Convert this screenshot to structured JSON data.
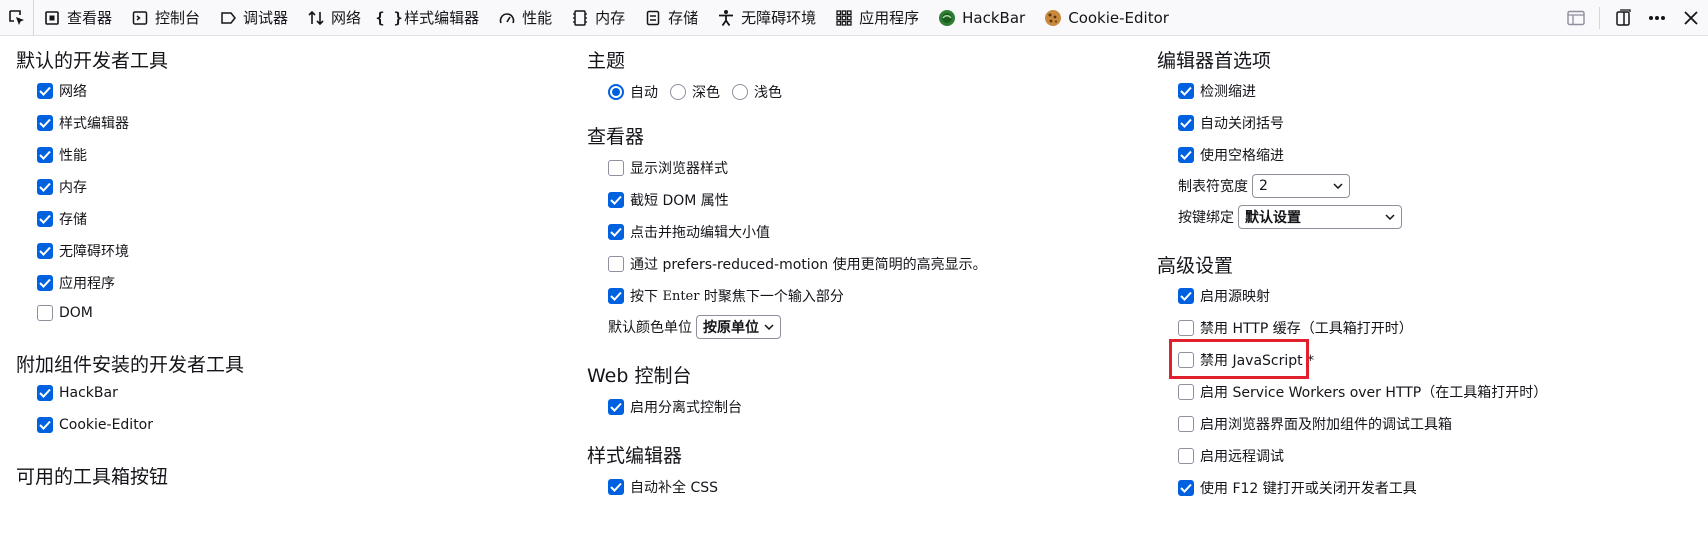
{
  "toolbar": {
    "tabs": [
      {
        "label": "查看器",
        "icon": "inspector-icon"
      },
      {
        "label": "控制台",
        "icon": "console-icon"
      },
      {
        "label": "调试器",
        "icon": "debugger-icon"
      },
      {
        "label": "网络",
        "icon": "network-icon"
      },
      {
        "label": "样式编辑器",
        "icon": "style-editor-icon"
      },
      {
        "label": "性能",
        "icon": "performance-icon"
      },
      {
        "label": "内存",
        "icon": "memory-icon"
      },
      {
        "label": "存储",
        "icon": "storage-icon"
      },
      {
        "label": "无障碍环境",
        "icon": "accessibility-icon"
      },
      {
        "label": "应用程序",
        "icon": "application-icon"
      },
      {
        "label": "HackBar",
        "icon": "hackbar-icon"
      },
      {
        "label": "Cookie-Editor",
        "icon": "cookie-icon"
      }
    ]
  },
  "default_tools": {
    "title": "默认的开发者工具",
    "items": [
      {
        "label": "网络",
        "checked": true
      },
      {
        "label": "样式编辑器",
        "checked": true
      },
      {
        "label": "性能",
        "checked": true
      },
      {
        "label": "内存",
        "checked": true
      },
      {
        "label": "存储",
        "checked": true
      },
      {
        "label": "无障碍环境",
        "checked": true
      },
      {
        "label": "应用程序",
        "checked": true
      },
      {
        "label": "DOM",
        "checked": false
      }
    ]
  },
  "addon_tools": {
    "title": "附加组件安装的开发者工具",
    "items": [
      {
        "label": "HackBar",
        "checked": true
      },
      {
        "label": "Cookie-Editor",
        "checked": true
      }
    ]
  },
  "toolbox_buttons": {
    "title": "可用的工具箱按钮"
  },
  "theme": {
    "title": "主题",
    "options": [
      {
        "label": "自动",
        "selected": true
      },
      {
        "label": "深色",
        "selected": false
      },
      {
        "label": "浅色",
        "selected": false
      }
    ]
  },
  "inspector": {
    "title": "查看器",
    "items": [
      {
        "label": "显示浏览器样式",
        "checked": false
      },
      {
        "label": "截短 DOM 属性",
        "checked": true
      },
      {
        "label": "点击并拖动编辑大小值",
        "checked": true
      },
      {
        "label": "通过 prefers-reduced-motion 使用更简明的高亮显示。",
        "checked": false
      }
    ],
    "enter_item": {
      "prefix": "按下 ",
      "key": "Enter",
      "suffix": " 时聚焦下一个输入部分",
      "checked": true
    },
    "color_unit_label": "默认颜色单位",
    "color_unit_value": "按原单位"
  },
  "web_console": {
    "title": "Web 控制台",
    "items": [
      {
        "label": "启用分离式控制台",
        "checked": true
      }
    ]
  },
  "style_editor": {
    "title": "样式编辑器",
    "items": [
      {
        "label": "自动补全 CSS",
        "checked": true
      }
    ]
  },
  "editor_prefs": {
    "title": "编辑器首选项",
    "items": [
      {
        "label": "检测缩进",
        "checked": true
      },
      {
        "label": "自动关闭括号",
        "checked": true
      },
      {
        "label": "使用空格缩进",
        "checked": true
      }
    ],
    "tab_width_label": "制表符宽度",
    "tab_width_value": "2",
    "keybinding_label": "按键绑定",
    "keybinding_value": "默认设置"
  },
  "advanced": {
    "title": "高级设置",
    "items": [
      {
        "label": "启用源映射",
        "checked": true
      },
      {
        "label": "禁用 HTTP 缓存（工具箱打开时）",
        "checked": false
      },
      {
        "label": "禁用 JavaScript *",
        "checked": false
      },
      {
        "label": "启用 Service Workers over HTTP（在工具箱打开时）",
        "checked": false
      },
      {
        "label": "启用浏览器界面及附加组件的调试工具箱",
        "checked": false
      },
      {
        "label": "启用远程调试",
        "checked": false
      },
      {
        "label": "使用 F12 键打开或关闭开发者工具",
        "checked": true
      }
    ]
  },
  "colors": {
    "accent": "#0061e0",
    "highlight": "#e0202c"
  }
}
